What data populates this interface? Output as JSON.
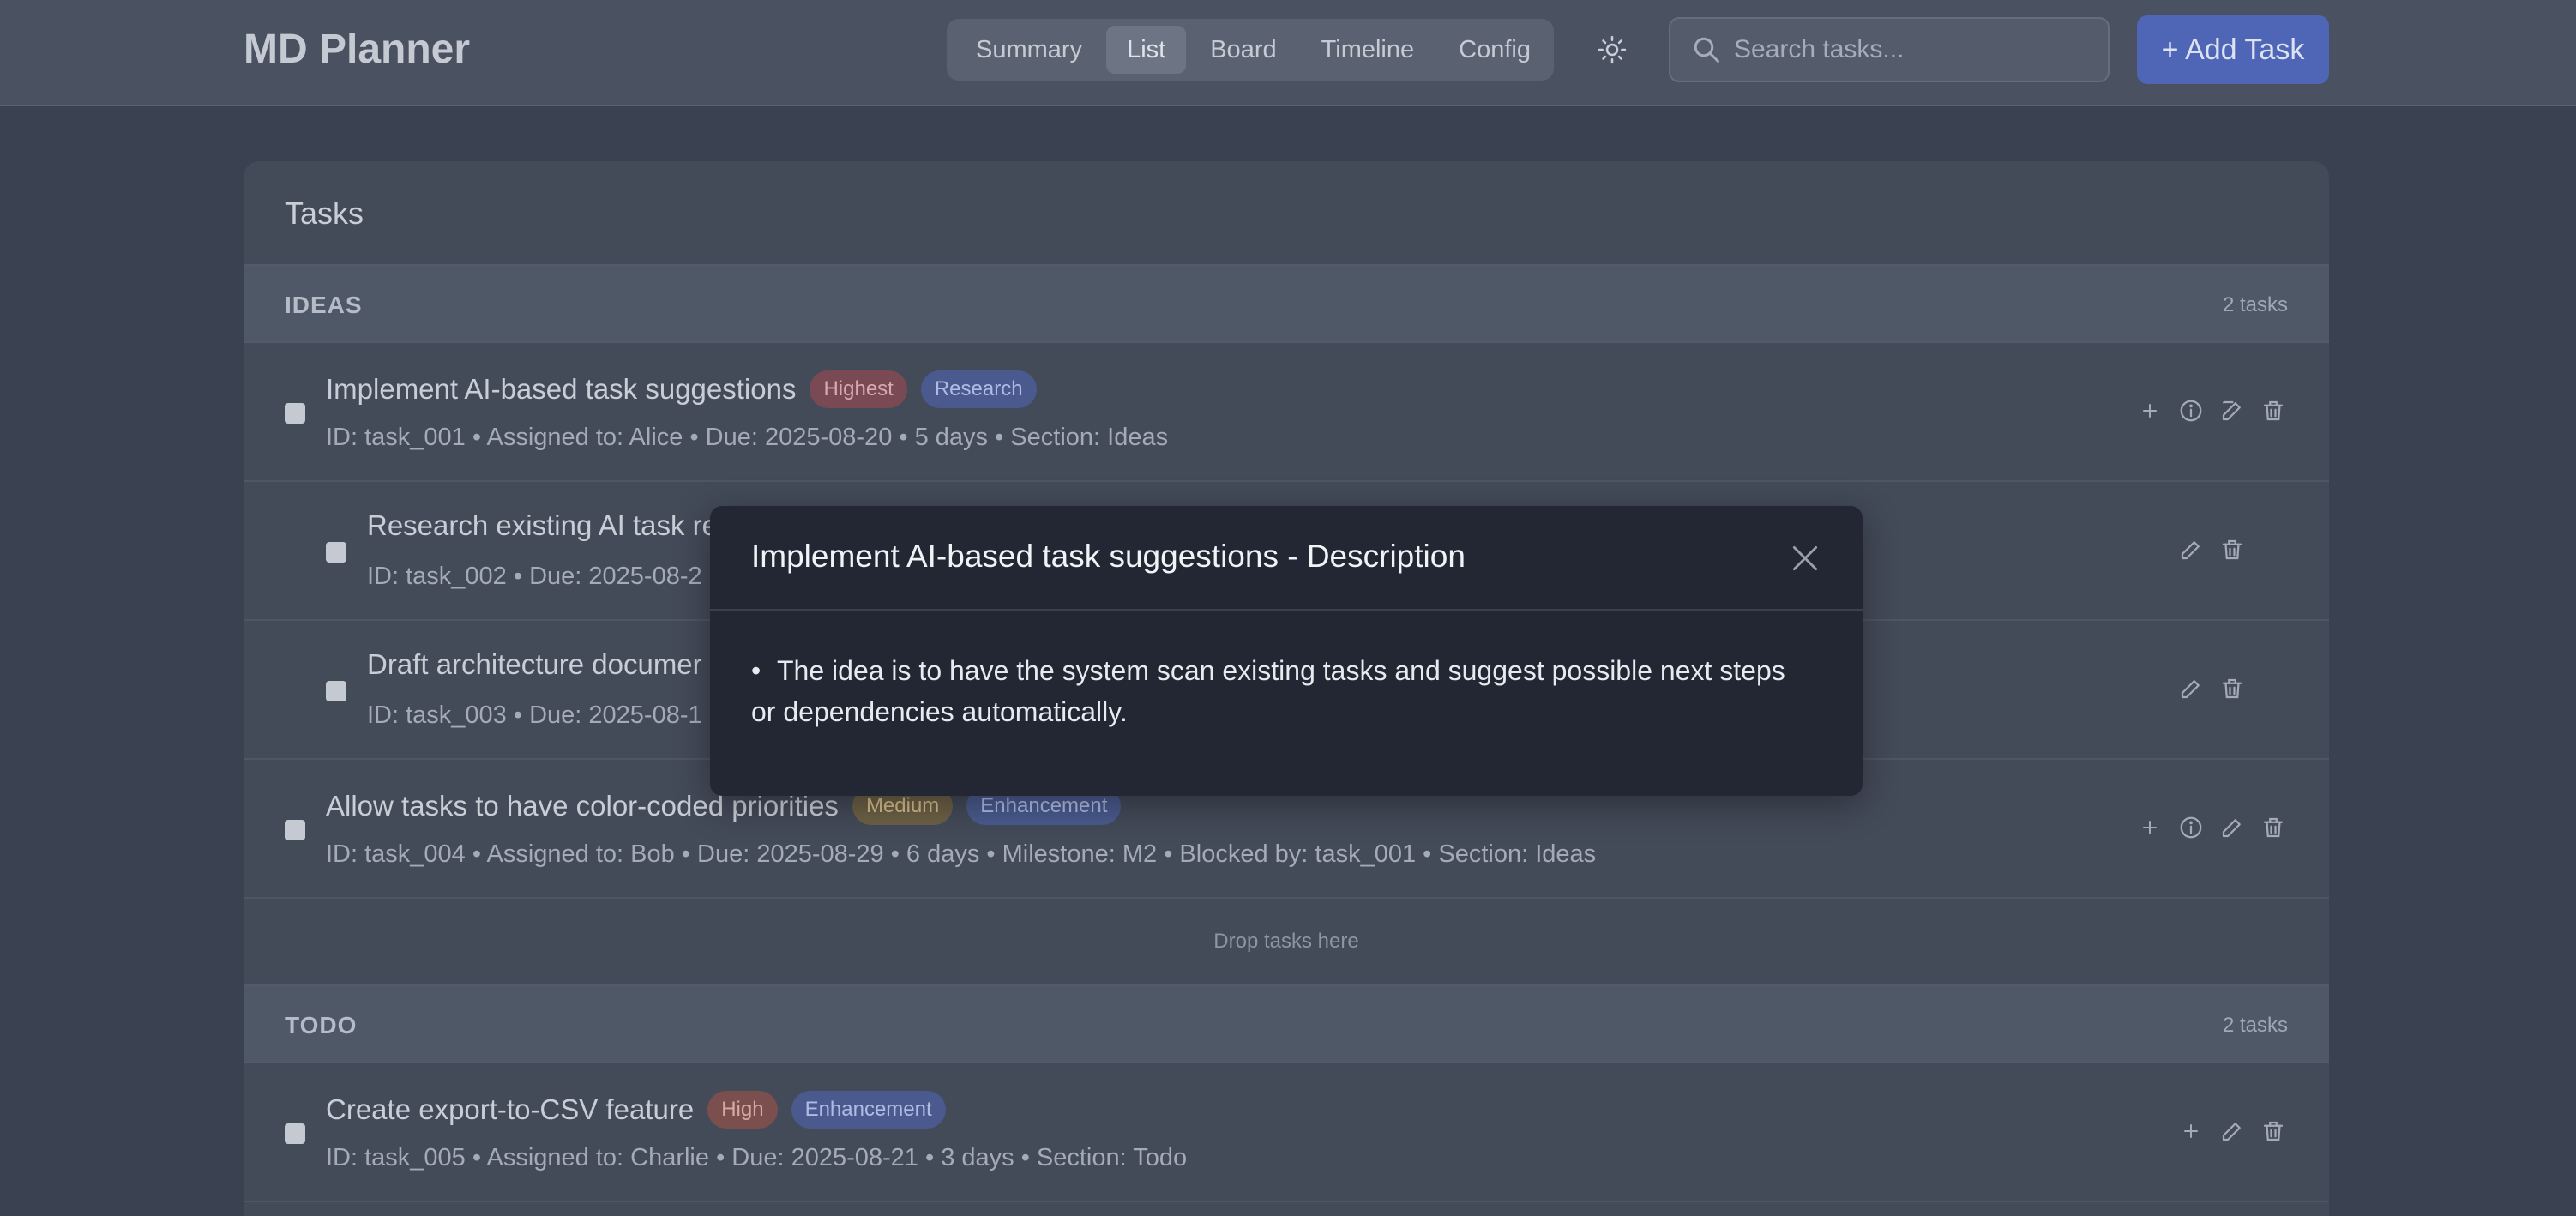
{
  "header": {
    "app_title": "MD Planner",
    "tabs": [
      {
        "label": "Summary",
        "active": false
      },
      {
        "label": "List",
        "active": true
      },
      {
        "label": "Board",
        "active": false
      },
      {
        "label": "Timeline",
        "active": false
      },
      {
        "label": "Config",
        "active": false
      }
    ],
    "theme_icon": "sun-icon",
    "search": {
      "placeholder": "Search tasks...",
      "value": ""
    },
    "add_button": "+ Add Task"
  },
  "panel": {
    "title": "Tasks",
    "sections": [
      {
        "name": "IDEAS",
        "count": "2 tasks",
        "tasks": [
          {
            "title": "Implement AI-based task suggestions",
            "tags": [
              "Highest",
              "Research"
            ],
            "meta": "ID: task_001 • Assigned to: Alice • Due: 2025-08-20 • 5 days • Section: Ideas"
          },
          {
            "title": "Research existing AI task re",
            "tags": [],
            "meta": "ID: task_002 • Due: 2025-08-2"
          },
          {
            "title": "Draft architecture documer",
            "tags": [],
            "meta": "ID: task_003 • Due: 2025-08-1"
          },
          {
            "title": "Allow tasks to have color-coded priorities",
            "tags": [
              "Medium",
              "Enhancement"
            ],
            "meta": "ID: task_004 • Assigned to: Bob • Due: 2025-08-29 • 6 days • Milestone: M2 • Blocked by: task_001 • Section: Ideas"
          }
        ],
        "drop_text": "Drop tasks here"
      },
      {
        "name": "TODO",
        "count": "2 tasks",
        "tasks": [
          {
            "title": "Create export-to-CSV feature",
            "tags": [
              "High",
              "Enhancement"
            ],
            "meta": "ID: task_005 • Assigned to: Charlie • Due: 2025-08-21 • 3 days • Section: Todo"
          }
        ]
      }
    ]
  },
  "modal": {
    "title": "Implement AI-based task suggestions - Description",
    "bullet": "•",
    "body_line1": "The idea is to have the system scan existing tasks and suggest possible next steps",
    "body_line2": "or dependencies automatically."
  },
  "colors": {
    "background": "#3a4150",
    "accent": "#4f66b6",
    "modal": "#222733"
  }
}
